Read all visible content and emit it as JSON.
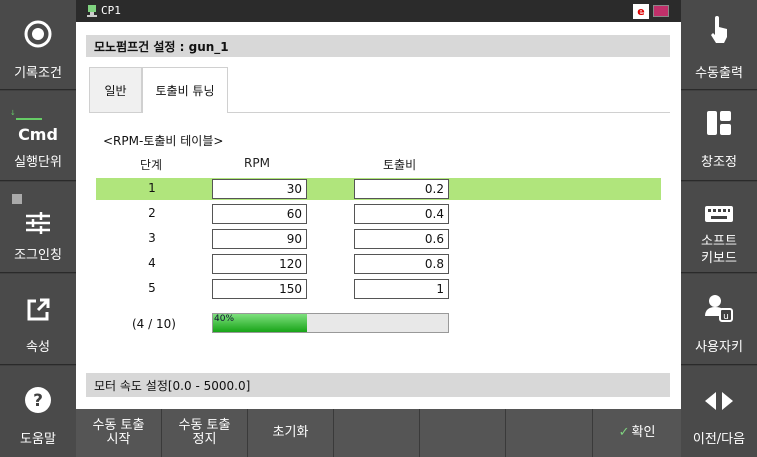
{
  "topbar": {
    "cp_label": "CP1",
    "e_badge": "e"
  },
  "left_panel": {
    "record_cond": "기록조건",
    "cmd": "Cmd",
    "exec_unit": "실행단위",
    "jog_inching": "조그인칭",
    "properties": "속성",
    "help": "도움말"
  },
  "right_panel": {
    "manual_output": "수동출력",
    "window_adjust": "창조정",
    "soft_keyboard_1": "소프트",
    "soft_keyboard_2": "키보드",
    "user_key": "사용자키",
    "prev_next": "이전/다음"
  },
  "main": {
    "title": "모노펌프건 설정 : gun_1",
    "tabs": [
      {
        "label": "일반"
      },
      {
        "label": "토출비 튜닝"
      }
    ],
    "section_label": "<RPM-토출비 테이블>",
    "headers": {
      "step": "단계",
      "rpm": "RPM",
      "ratio": "토출비"
    },
    "rows": [
      {
        "step": "1",
        "rpm": "30",
        "ratio": "0.2"
      },
      {
        "step": "2",
        "rpm": "60",
        "ratio": "0.4"
      },
      {
        "step": "3",
        "rpm": "90",
        "ratio": "0.6"
      },
      {
        "step": "4",
        "rpm": "120",
        "ratio": "0.8"
      },
      {
        "step": "5",
        "rpm": "150",
        "ratio": "1"
      }
    ],
    "progress": {
      "label": "(4 / 10)",
      "percent_text": "40%",
      "value": 0.4
    },
    "footer": "모터 속도 설정[0.0 - 5000.0]"
  },
  "bottombar": {
    "start_manual_1": "수동 토출",
    "start_manual_2": "시작",
    "stop_manual_1": "수동 토출",
    "stop_manual_2": "정지",
    "reset": "초기화",
    "confirm": "확인"
  },
  "colors": {
    "selected_row": "#b0e57c",
    "progress_fill": "#18a418"
  }
}
